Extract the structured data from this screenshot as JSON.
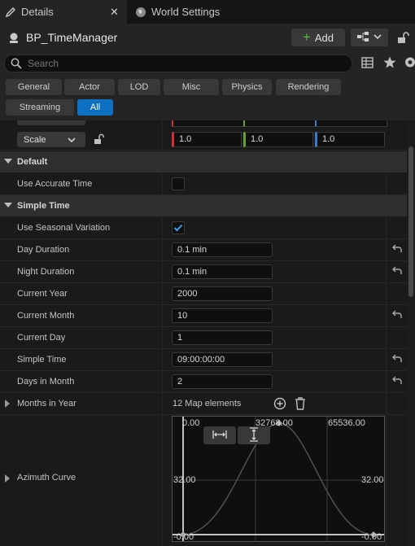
{
  "tabs": [
    {
      "label": "Details",
      "icon": "pencil-icon"
    },
    {
      "label": "World Settings",
      "icon": "globe-icon"
    }
  ],
  "header": {
    "title": "BP_TimeManager",
    "add_label": "Add"
  },
  "search": {
    "placeholder": "Search"
  },
  "filters": [
    "General",
    "Actor",
    "LOD",
    "Misc",
    "Physics",
    "Rendering",
    "Streaming",
    "All"
  ],
  "transform": {
    "scale_label": "Scale",
    "x": "1.0",
    "y": "1.0",
    "z": "1.0"
  },
  "sections": {
    "default": {
      "title": "Default",
      "use_accurate_time": {
        "label": "Use Accurate Time",
        "checked": false
      }
    },
    "simple_time": {
      "title": "Simple Time",
      "use_seasonal_variation": {
        "label": "Use Seasonal Variation",
        "checked": true
      },
      "day_duration": {
        "label": "Day Duration",
        "value": "0.1 min"
      },
      "night_duration": {
        "label": "Night Duration",
        "value": "0.1 min"
      },
      "current_year": {
        "label": "Current Year",
        "value": "2000"
      },
      "current_month": {
        "label": "Current Month",
        "value": "10"
      },
      "current_day": {
        "label": "Current Day",
        "value": "1"
      },
      "simple_time": {
        "label": "Simple Time",
        "value": "09:00:00:00"
      },
      "days_in_month": {
        "label": "Days in Month",
        "value": "2"
      },
      "months_in_year": {
        "label": "Months in Year",
        "value": "12 Map elements"
      },
      "azimuth_curve": {
        "label": "Azimuth Curve",
        "x_left": "0.00",
        "x_mid": "32768.00",
        "x_right": "65536.00",
        "y_left": "32.00",
        "y_right": "32.00",
        "y_bottom_left": "-0.00",
        "y_bottom_right": "-0.00"
      }
    }
  },
  "colors": {
    "accent": "#0e70c0",
    "x_axis": "#c83232",
    "y_axis": "#6aa032",
    "z_axis": "#3c78c8",
    "add_plus": "#6ab04c"
  }
}
